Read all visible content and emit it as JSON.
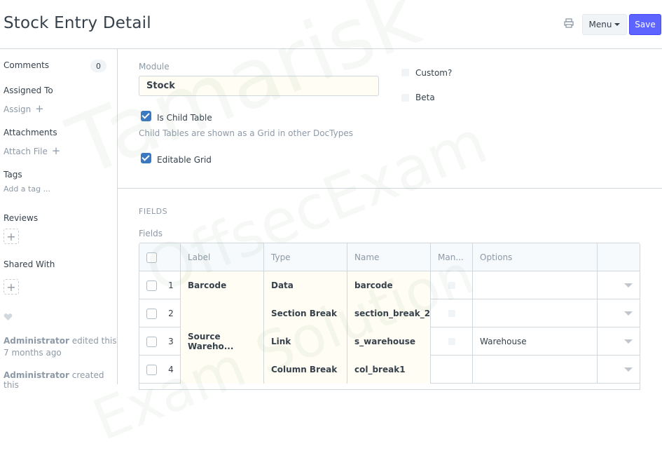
{
  "header": {
    "title": "Stock Entry Detail",
    "menu_label": "Menu",
    "save_label": "Save"
  },
  "sidebar": {
    "comments_label": "Comments",
    "comments_count": "0",
    "assigned_to_label": "Assigned To",
    "assign_link": "Assign",
    "attachments_label": "Attachments",
    "attach_file_link": "Attach File",
    "tags_label": "Tags",
    "add_tag_link": "Add a tag ...",
    "reviews_label": "Reviews",
    "shared_with_label": "Shared With",
    "activity": [
      {
        "user": "Administrator",
        "action": "edited this",
        "time": "7 months ago"
      },
      {
        "user": "Administrator",
        "action": "created this",
        "time": ""
      }
    ]
  },
  "form": {
    "module_label": "Module",
    "module_value": "Stock",
    "custom_label": "Custom?",
    "custom_checked": false,
    "beta_label": "Beta",
    "beta_checked": false,
    "is_child_table_label": "Is Child Table",
    "is_child_table_checked": true,
    "is_child_table_help": "Child Tables are shown as a Grid in other DocTypes",
    "editable_grid_label": "Editable Grid",
    "editable_grid_checked": true
  },
  "fields_section": {
    "section_title": "FIELDS",
    "grid_label": "Fields",
    "columns": [
      "Label",
      "Type",
      "Name",
      "Man...",
      "Options"
    ],
    "rows": [
      {
        "idx": "1",
        "label": "Barcode",
        "type": "Data",
        "name": "barcode",
        "options": ""
      },
      {
        "idx": "2",
        "label": "",
        "type": "Section Break",
        "name": "section_break_2",
        "options": ""
      },
      {
        "idx": "3",
        "label": "Source Wareho...",
        "type": "Link",
        "name": "s_warehouse",
        "options": "Warehouse"
      },
      {
        "idx": "4",
        "label": "",
        "type": "Column Break",
        "name": "col_break1",
        "options": ""
      }
    ]
  },
  "watermark": {
    "line1": "Tamarisk",
    "line2": "OffsecExam",
    "line3": "Exam Solution"
  },
  "colors": {
    "primary": "#5e64ff",
    "checkbox": "#3b78c2",
    "muted_text": "#8d99a6",
    "border": "#d1d8dd"
  }
}
